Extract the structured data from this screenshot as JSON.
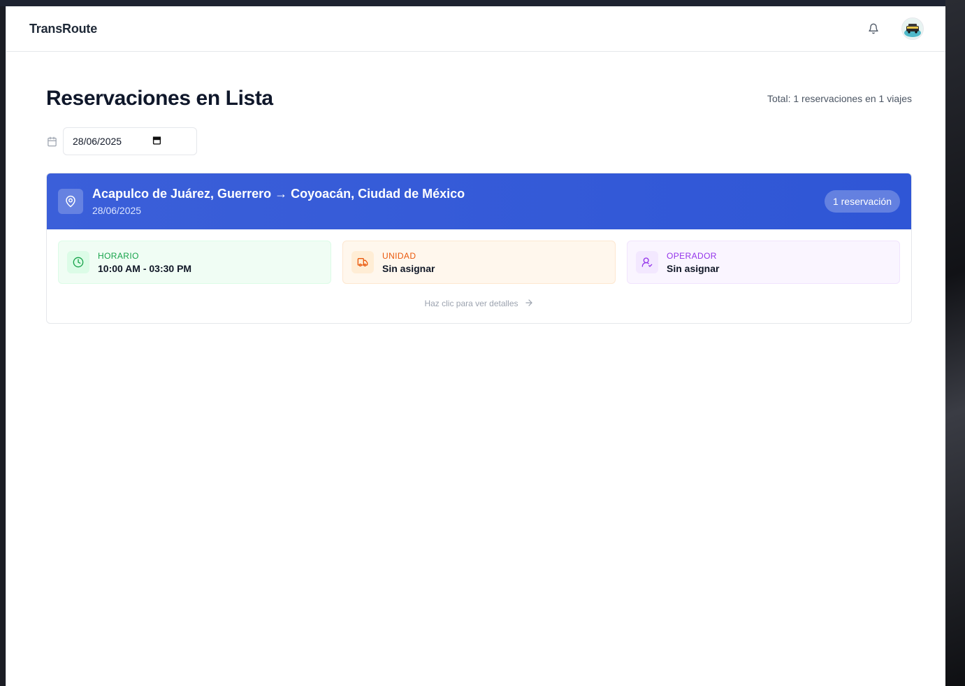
{
  "app": {
    "brand": "TransRoute"
  },
  "header": {
    "notifications_icon": "bell-icon",
    "avatar_icon": "avatar-image"
  },
  "page": {
    "title": "Reservaciones en Lista",
    "total": "Total: 1 reservaciones en 1 viajes"
  },
  "filter": {
    "date_value": "28/06/2025",
    "calendar_icon": "calendar-icon"
  },
  "trip": {
    "route": "Acapulco de Juárez, Guerrero → Coyoacán, Ciudad de México",
    "date": "28/06/2025",
    "badge": "1 reservación",
    "tiles": [
      {
        "label": "HORARIO",
        "value": "10:00 AM - 03:30 PM",
        "icon": "clock-icon"
      },
      {
        "label": "UNIDAD",
        "value": "Sin asignar",
        "icon": "truck-icon"
      },
      {
        "label": "OPERADOR",
        "value": "Sin asignar",
        "icon": "user-check-icon"
      }
    ],
    "details": "Haz clic para ver detalles"
  },
  "colors": {
    "header_blue": "#3b5fd9",
    "green": "#16a34a",
    "orange": "#ea580c",
    "purple": "#9333ea"
  }
}
